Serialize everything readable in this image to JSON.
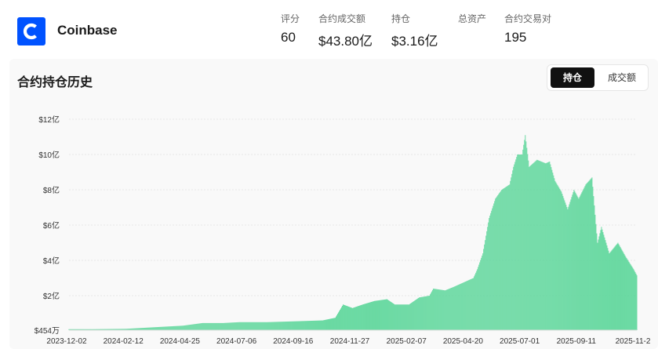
{
  "exchange": {
    "name": "Coinbase",
    "brand_color": "#0052ff",
    "logo_icon": "coinbase-c-icon"
  },
  "stats": [
    {
      "label": "评分",
      "value": "60"
    },
    {
      "label": "合约成交额",
      "value": "$43.80亿"
    },
    {
      "label": "持仓",
      "value": "$3.16亿"
    },
    {
      "label": "总资产",
      "value": ""
    },
    {
      "label": "合约交易对",
      "value": "195"
    }
  ],
  "section": {
    "title": "合约持仓历史"
  },
  "toggle": {
    "active_label": "持仓",
    "inactive_label": "成交额"
  },
  "chart_data": {
    "type": "bar",
    "title": "",
    "xlabel": "",
    "ylabel": "",
    "bar_color": "#5cd69a",
    "y_unit": "亿 USD",
    "ylim": [
      0.04544,
      12
    ],
    "y_ticks": [
      {
        "value": 0.04544,
        "label": "$454万"
      },
      {
        "value": 2,
        "label": "$2亿"
      },
      {
        "value": 4,
        "label": "$4亿"
      },
      {
        "value": 6,
        "label": "$6亿"
      },
      {
        "value": 8,
        "label": "$8亿"
      },
      {
        "value": 10,
        "label": "$10亿"
      },
      {
        "value": 12,
        "label": "$12亿"
      }
    ],
    "x_range": [
      "2023-12-02",
      "2025-11-24"
    ],
    "x_ticks": [
      "2023-12-02",
      "2024-02-12",
      "2024-04-25",
      "2024-07-06",
      "2024-09-16",
      "2024-11-27",
      "2025-02-07",
      "2025-04-20",
      "2025-07-01",
      "2025-09-11",
      "2025-11-2"
    ],
    "grid": true,
    "legend": "none",
    "series": [
      {
        "points": [
          [
            "2023-12-02",
            0.1
          ],
          [
            "2024-01-01",
            0.1
          ],
          [
            "2024-02-12",
            0.12
          ],
          [
            "2024-03-15",
            0.2
          ],
          [
            "2024-04-25",
            0.3
          ],
          [
            "2024-05-20",
            0.45
          ],
          [
            "2024-06-15",
            0.45
          ],
          [
            "2024-07-06",
            0.5
          ],
          [
            "2024-08-10",
            0.5
          ],
          [
            "2024-09-16",
            0.55
          ],
          [
            "2024-10-20",
            0.6
          ],
          [
            "2024-11-05",
            0.75
          ],
          [
            "2024-11-15",
            1.5
          ],
          [
            "2024-11-27",
            1.3
          ],
          [
            "2024-12-10",
            1.5
          ],
          [
            "2024-12-25",
            1.7
          ],
          [
            "2025-01-10",
            1.8
          ],
          [
            "2025-01-20",
            1.5
          ],
          [
            "2025-02-07",
            1.5
          ],
          [
            "2025-02-20",
            1.9
          ],
          [
            "2025-03-05",
            2.0
          ],
          [
            "2025-03-10",
            2.4
          ],
          [
            "2025-03-25",
            2.3
          ],
          [
            "2025-04-05",
            2.5
          ],
          [
            "2025-04-20",
            2.8
          ],
          [
            "2025-04-30",
            3.0
          ],
          [
            "2025-05-05",
            3.5
          ],
          [
            "2025-05-12",
            4.4
          ],
          [
            "2025-05-20",
            6.4
          ],
          [
            "2025-05-28",
            7.5
          ],
          [
            "2025-06-05",
            8.0
          ],
          [
            "2025-06-15",
            8.3
          ],
          [
            "2025-06-20",
            9.3
          ],
          [
            "2025-06-25",
            10.0
          ],
          [
            "2025-07-01",
            10.0
          ],
          [
            "2025-07-05",
            11.1
          ],
          [
            "2025-07-10",
            9.3
          ],
          [
            "2025-07-20",
            9.7
          ],
          [
            "2025-07-31",
            9.5
          ],
          [
            "2025-08-05",
            9.6
          ],
          [
            "2025-08-12",
            8.5
          ],
          [
            "2025-08-20",
            7.9
          ],
          [
            "2025-08-28",
            6.9
          ],
          [
            "2025-09-05",
            8.0
          ],
          [
            "2025-09-11",
            7.5
          ],
          [
            "2025-09-20",
            8.3
          ],
          [
            "2025-09-28",
            8.7
          ],
          [
            "2025-10-05",
            5.0
          ],
          [
            "2025-10-10",
            5.9
          ],
          [
            "2025-10-20",
            4.4
          ],
          [
            "2025-10-31",
            5.0
          ],
          [
            "2025-11-10",
            4.2
          ],
          [
            "2025-11-20",
            3.5
          ],
          [
            "2025-11-24",
            3.16
          ]
        ]
      }
    ]
  }
}
